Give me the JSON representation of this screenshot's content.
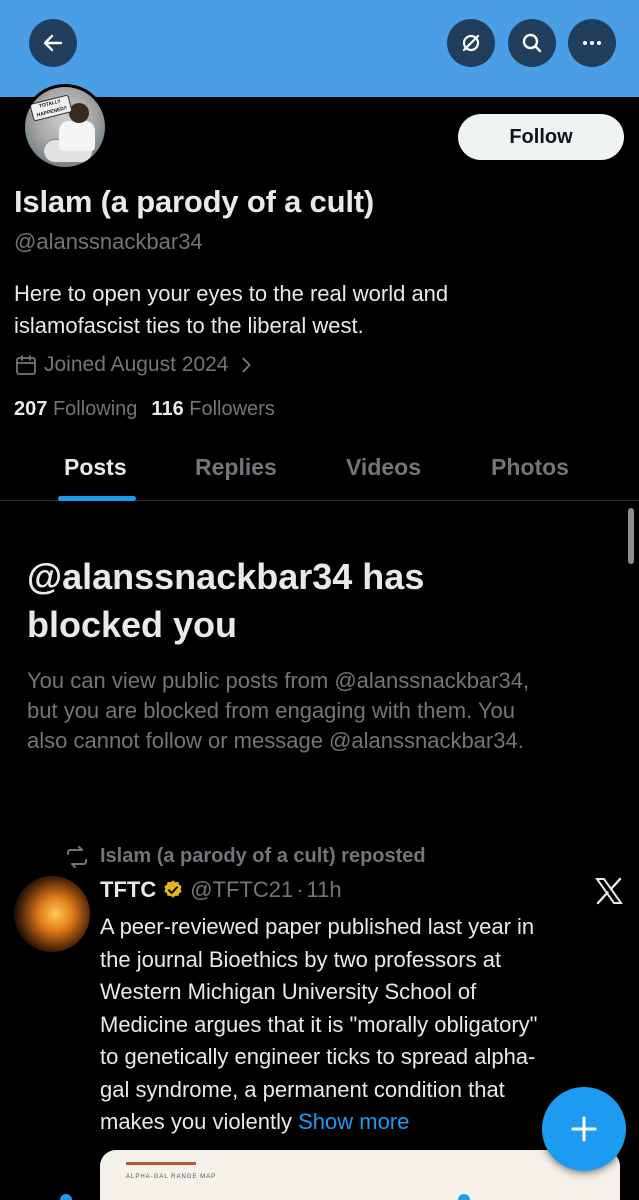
{
  "header": {
    "back_icon": "arrow-left-icon",
    "nav_icons": [
      "hide-icon",
      "search-icon",
      "more-icon"
    ]
  },
  "profile": {
    "avatar_stamp": "TOTALLY HAPPENED!!",
    "follow_label": "Follow",
    "display_name": "Islam (a parody of a cult)",
    "handle": "@alanssnackbar34",
    "bio_line1": "Here to open your eyes to the real world and",
    "bio_line2": "islamofascist ties to the liberal west.",
    "joined": "Joined August 2024",
    "following_count": "207",
    "following_label": "Following",
    "followers_count": "116",
    "followers_label": "Followers"
  },
  "tabs": [
    {
      "label": "Posts",
      "active": true
    },
    {
      "label": "Replies",
      "active": false
    },
    {
      "label": "Videos",
      "active": false
    },
    {
      "label": "Photos",
      "active": false
    }
  ],
  "blocked": {
    "title_line1": "@alanssnackbar34 has",
    "title_line2": "blocked you",
    "desc_line1": "You can view public posts from @alanssnackbar34,",
    "desc_line2": "but you are blocked from engaging with them. You",
    "desc_line3": "also cannot follow or message @alanssnackbar34."
  },
  "tweet": {
    "repost_label": "Islam (a parody of a cult) reposted",
    "author_name": "TFTC",
    "author_handle": "@TFTC21",
    "separator": "·",
    "time": "11h",
    "lines": [
      "A peer-reviewed paper published last year in",
      "the journal Bioethics by two professors at",
      "Western Michigan University School of",
      "Medicine argues that it is \"morally obligatory\"",
      "to genetically engineer ticks to spread alpha-",
      "gal syndrome, a permanent condition that",
      "makes you violently "
    ],
    "show_more": "Show more",
    "media_label": "ALPHA-GAL RANGE MAP"
  },
  "fab": {
    "icon": "plus-icon"
  },
  "colors": {
    "banner": "#4a9ee6",
    "accent": "#1d9bf0",
    "background": "#000000",
    "primary_text": "#e7e9ea",
    "secondary_text": "#71767b",
    "verified_badge": "#e2b719"
  }
}
